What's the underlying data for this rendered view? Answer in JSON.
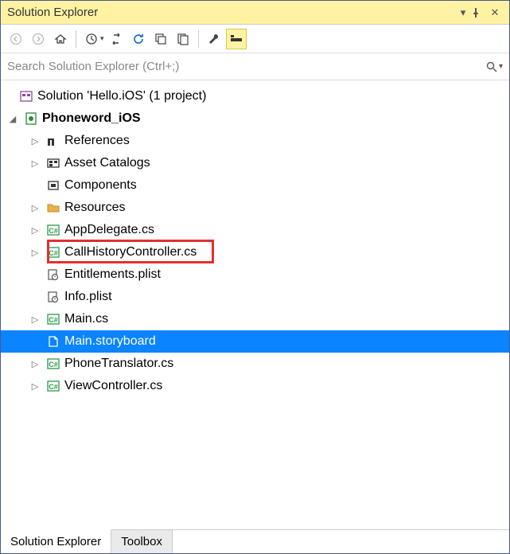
{
  "titlebar": {
    "title": "Solution Explorer"
  },
  "search": {
    "placeholder": "Search Solution Explorer (Ctrl+;)"
  },
  "tree": {
    "solution_label": "Solution 'Hello.iOS' (1 project)",
    "project_label": "Phoneword_iOS",
    "items": [
      {
        "label": "References",
        "icon": "references",
        "arrow": true
      },
      {
        "label": "Asset Catalogs",
        "icon": "asset-catalogs",
        "arrow": true
      },
      {
        "label": "Components",
        "icon": "components",
        "arrow": false
      },
      {
        "label": "Resources",
        "icon": "folder",
        "arrow": true
      },
      {
        "label": "AppDelegate.cs",
        "icon": "csharp",
        "arrow": true
      },
      {
        "label": "CallHistoryController.cs",
        "icon": "csharp",
        "arrow": true,
        "highlight": true
      },
      {
        "label": "Entitlements.plist",
        "icon": "plist",
        "arrow": false
      },
      {
        "label": "Info.plist",
        "icon": "plist",
        "arrow": false
      },
      {
        "label": "Main.cs",
        "icon": "csharp",
        "arrow": true
      },
      {
        "label": "Main.storyboard",
        "icon": "file",
        "arrow": false,
        "selected": true
      },
      {
        "label": "PhoneTranslator.cs",
        "icon": "csharp",
        "arrow": true
      },
      {
        "label": "ViewController.cs",
        "icon": "csharp",
        "arrow": true
      }
    ]
  },
  "tabs": {
    "active": "Solution Explorer",
    "items": [
      "Solution Explorer",
      "Toolbox"
    ]
  }
}
